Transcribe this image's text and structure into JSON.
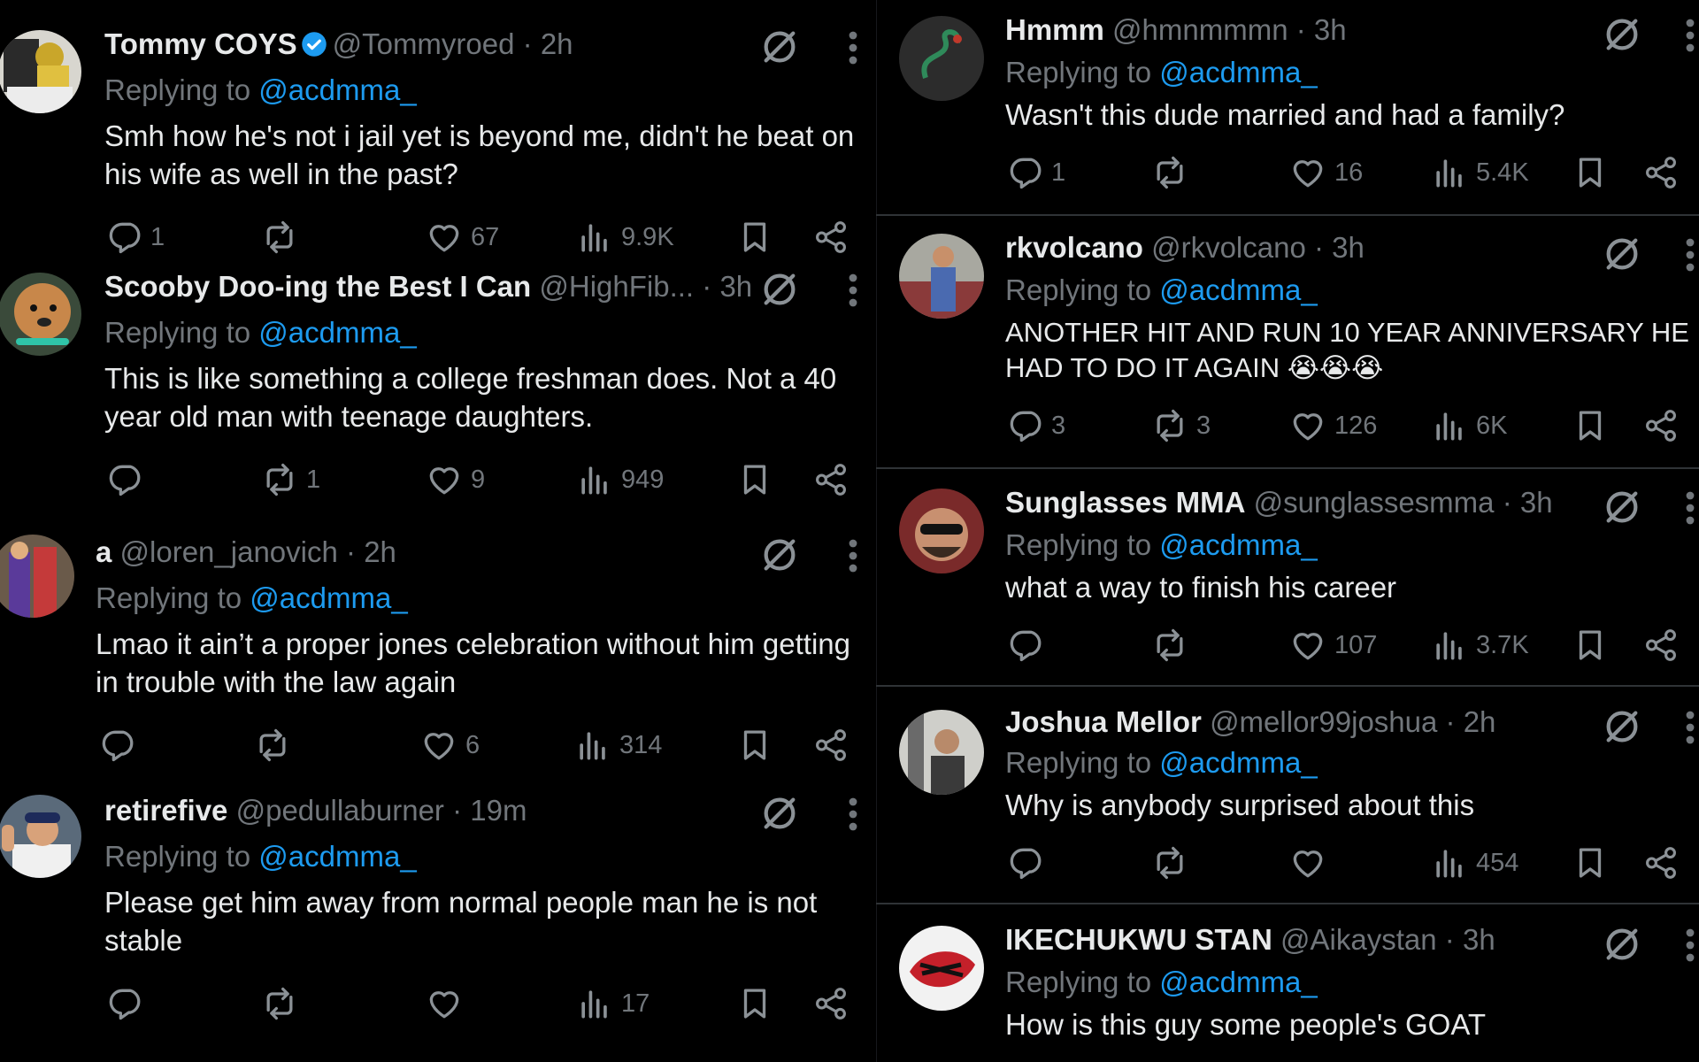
{
  "left_replies": [
    {
      "name": "Tommy COYS",
      "verified": true,
      "handle": "@Tommyroed",
      "dot": "·",
      "time": "2h",
      "replying_prefix": "Replying to",
      "replying_to": "@acdmma_",
      "text": "Smh how he's not i jail yet is beyond me, didn't he beat on his wife as well in the past?",
      "replies": "1",
      "reposts": "",
      "likes": "67",
      "views": "9.9K"
    },
    {
      "name": "Scooby Doo-ing the Best I Can",
      "verified": false,
      "handle": "@HighFib...",
      "dot": "·",
      "time": "3h",
      "replying_prefix": "Replying to",
      "replying_to": "@acdmma_",
      "text": "This is like something a college freshman does. Not a 40 year old man with teenage daughters.",
      "replies": "",
      "reposts": "1",
      "likes": "9",
      "views": "949"
    },
    {
      "name": "a",
      "verified": false,
      "handle": "@loren_janovich",
      "dot": "·",
      "time": "2h",
      "replying_prefix": "Replying to",
      "replying_to": "@acdmma_",
      "text": "Lmao it ain’t a proper jones celebration without him getting in trouble with the law again",
      "replies": "",
      "reposts": "",
      "likes": "6",
      "views": "314"
    },
    {
      "name": "retirefive",
      "verified": false,
      "handle": "@pedullaburner",
      "dot": "·",
      "time": "19m",
      "replying_prefix": "Replying to",
      "replying_to": "@acdmma_",
      "text": "Please get him away from normal people man he is not stable",
      "replies": "",
      "reposts": "",
      "likes": "",
      "views": "17"
    }
  ],
  "right_replies": [
    {
      "name": "Hmmm",
      "handle": "@hmnmmmn",
      "dot": "·",
      "time": "3h",
      "replying_prefix": "Replying to",
      "replying_to": "@acdmma_",
      "text": "Wasn't this dude married and had a family?",
      "replies": "1",
      "reposts": "",
      "likes": "16",
      "views": "5.4K"
    },
    {
      "name": "rkvolcano",
      "handle": "@rkvolcano",
      "dot": "·",
      "time": "3h",
      "replying_prefix": "Replying to",
      "replying_to": "@acdmma_",
      "text": "ANOTHER HIT AND RUN 10 YEAR ANNIVERSARY HE HAD TO DO IT AGAIN 😭😭😭",
      "replies": "3",
      "reposts": "3",
      "likes": "126",
      "views": "6K"
    },
    {
      "name": "Sunglasses MMA",
      "handle": "@sunglassesmma",
      "dot": "·",
      "time": "3h",
      "replying_prefix": "Replying to",
      "replying_to": "@acdmma_",
      "text": "what a way to finish his career",
      "replies": "",
      "reposts": "",
      "likes": "107",
      "views": "3.7K"
    },
    {
      "name": "Joshua Mellor",
      "handle": "@mellor99joshua",
      "dot": "·",
      "time": "2h",
      "replying_prefix": "Replying to",
      "replying_to": "@acdmma_",
      "text": "Why is anybody surprised about this",
      "replies": "",
      "reposts": "",
      "likes": "",
      "views": "454"
    },
    {
      "name": "IKECHUKWU STAN",
      "handle": "@Aikaystan",
      "dot": "·",
      "time": "3h",
      "replying_prefix": "Replying to",
      "replying_to": "@acdmma_",
      "text": "How is this guy some people's GOAT"
    }
  ],
  "colors": {
    "background": "#000000",
    "text_primary": "#e7e9ea",
    "text_secondary": "#71767b",
    "mention": "#1d9bf0",
    "divider": "#2f3336"
  },
  "icons": [
    "verified-badge-icon",
    "grok-icon",
    "more-icon",
    "reply-icon",
    "repost-icon",
    "like-icon",
    "views-icon",
    "bookmark-icon",
    "share-icon"
  ]
}
